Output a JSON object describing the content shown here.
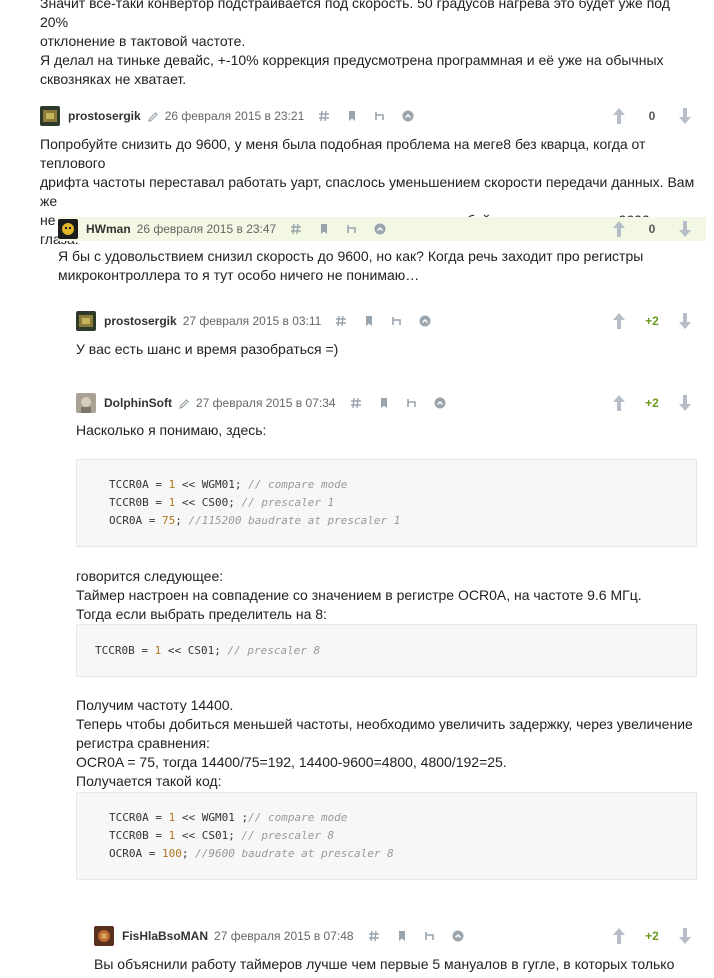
{
  "top_text": {
    "lines": [
      "Значит все-таки конвертор подстраивается под скорость. 50 градусов нагрева это будет уже под 20%",
      "отклонение в тактовой частоте.",
      "Я делал на тиньке девайс, +-10% коррекция предусмотрена программная и её уже на обычных",
      "сквозняках не хватает."
    ]
  },
  "comments": [
    {
      "author": "prostosergik",
      "date": "26 февраля 2015 в 23:21",
      "score": "0",
      "avatar_icon": "avatar-image",
      "lines": [
        "Попробуйте снизить до 9600, у меня была подобная проблема на меге8 без кварца, когда от теплового",
        "дрифта частоты переставал работать уарт, спаслось уменьшением скорости передачи данных. Вам же",
        "не потоковое аудио слать, а мелкие строки, скорее всего — пару байт в секунду, так что 9600 за глаза."
      ]
    },
    {
      "author": "HWman",
      "date": "26 февраля 2015 в 23:47",
      "score": "0",
      "avatar_icon": "avatar-image",
      "lines": [
        "Я бы с удовольствием снизил скорость до 9600, но как? Когда речь заходит про регистры",
        "микроконтроллера то я тут особо ничего не понимаю…"
      ]
    },
    {
      "author": "prostosergik",
      "date": "27 февраля 2015 в 03:11",
      "score": "+2",
      "avatar_icon": "avatar-image",
      "lines": [
        "У вас есть шанс и время разобраться =)"
      ]
    },
    {
      "author": "DolphinSoft",
      "date": "27 февраля 2015 в 07:34",
      "score": "+2",
      "avatar_icon": "avatar-image",
      "intro": "Насколько я понимаю, здесь:",
      "code1": [
        {
          "a": "TCCR0A = ",
          "n": "1",
          "b": " << WGM01; ",
          "c": "// compare mode"
        },
        {
          "a": "TCCR0B = ",
          "n": "1",
          "b": " << CS00; ",
          "c": "// prescaler 1"
        },
        {
          "a": "OCR0A = ",
          "n": "75",
          "b": "; ",
          "c": "//115200 baudrate at prescaler 1"
        }
      ],
      "mid_lines": [
        "говорится следующее:",
        "Таймер настроен на совпадение со значением в регистре OCR0A, на частоте 9.6 МГц.",
        "Тогда если выбрать пределитель на 8:"
      ],
      "code2": [
        {
          "a": "TCCR0B = ",
          "n": "1",
          "b": " << CS01; ",
          "c": "// prescaler 8"
        }
      ],
      "after_lines": [
        "Получим частоту 14400.",
        "Теперь чтобы добиться меньшей частоты, необходимо увеличить задержку, через увеличение",
        "регистра сравнения:",
        "OCR0A = 75, тогда 14400/75=192, 14400-9600=4800, 4800/192=25.",
        "Получается такой код:"
      ],
      "code3": [
        {
          "a": "TCCR0A = ",
          "n": "1",
          "b": " << WGM01 ;",
          "c": "// compare mode"
        },
        {
          "a": "TCCR0B = ",
          "n": "1",
          "b": " << CS01; ",
          "c": "// prescaler 8"
        },
        {
          "a": "OCR0A = ",
          "n": "100",
          "b": "; ",
          "c": "//9600 baudrate at prescaler 8"
        }
      ]
    },
    {
      "author": "FisHlaBsoMAN",
      "date": "27 февраля 2015 в 07:48",
      "score": "+2",
      "avatar_icon": "avatar-image",
      "lines": [
        "Вы объяснили работу таймеров лучше чем первые 5 мануалов в гугле, в которых только"
      ]
    }
  ],
  "colors": {
    "highlight_bg": "#f2f8e4",
    "positive_score": "#6c9a1f",
    "icon_color": "#9aa4ad",
    "code_number": "#b0761a"
  }
}
